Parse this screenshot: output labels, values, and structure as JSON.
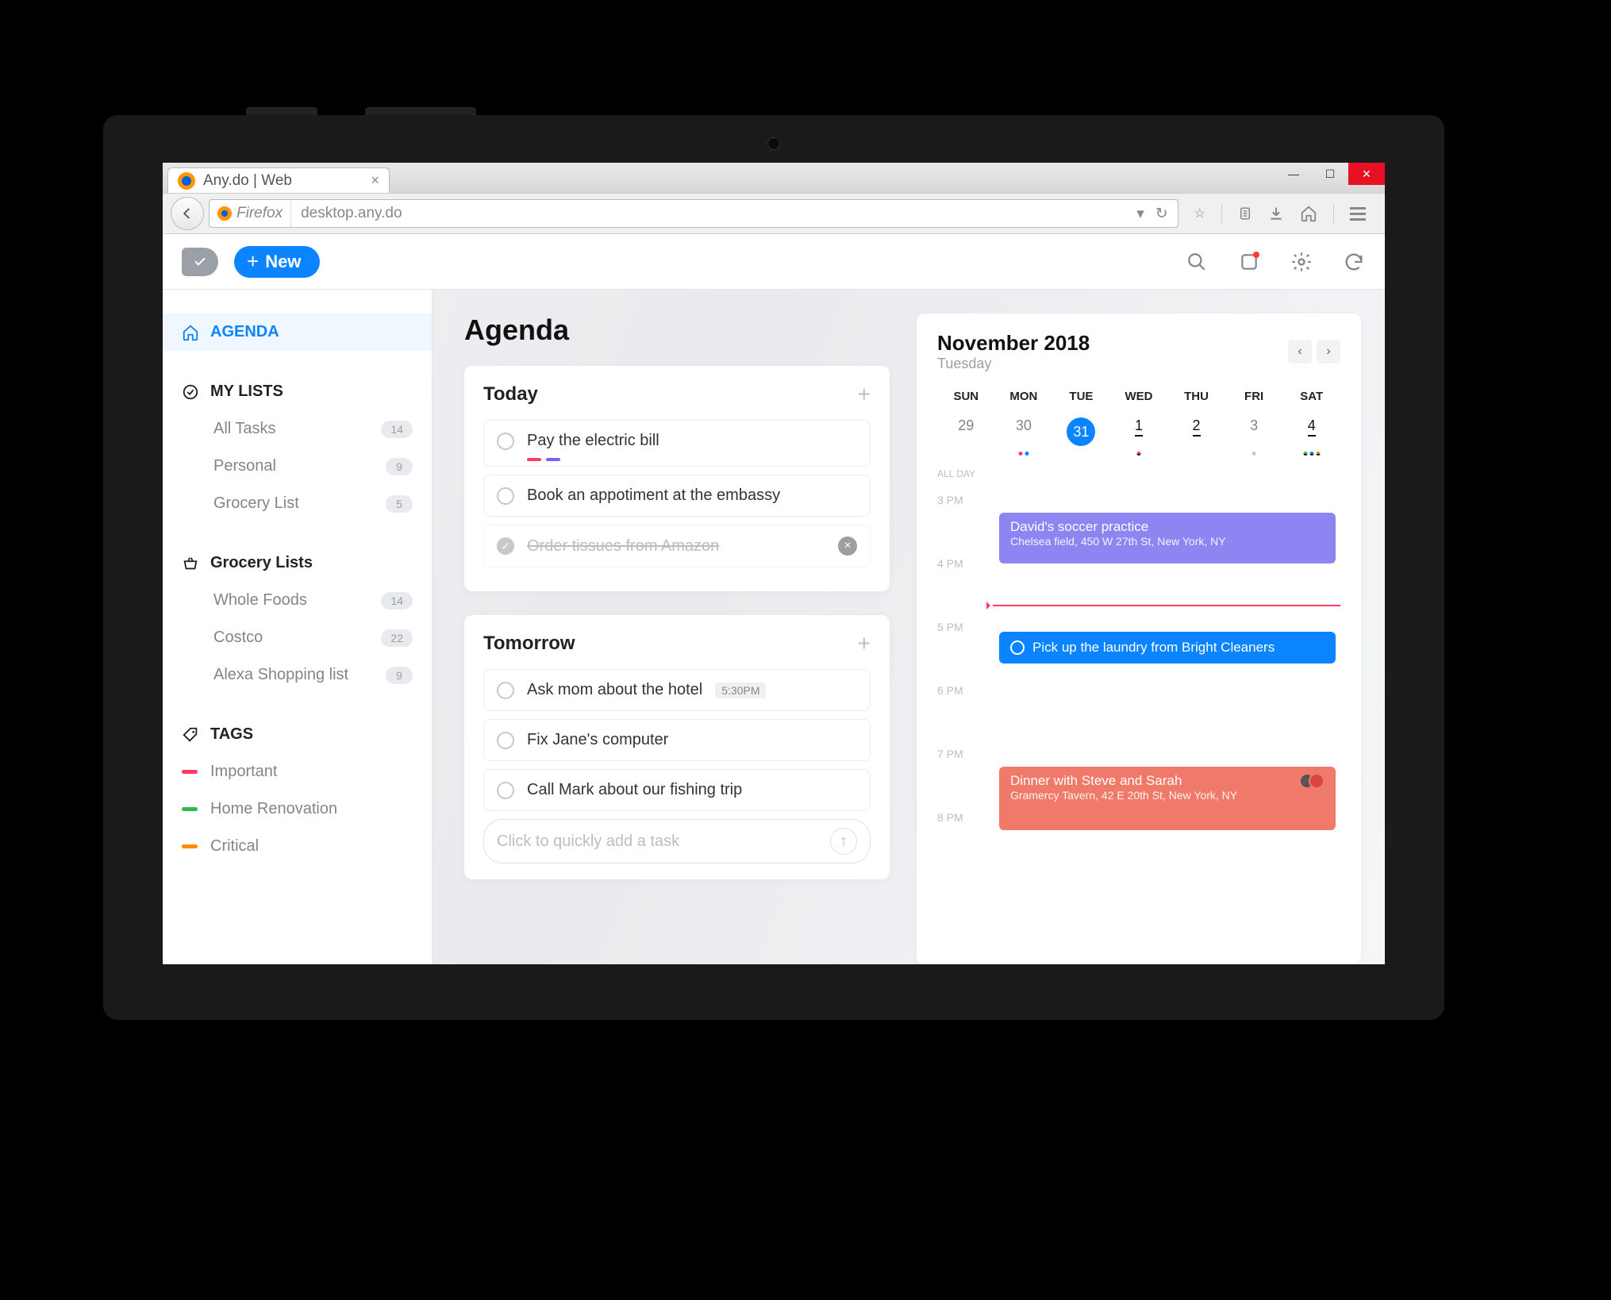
{
  "browser": {
    "tab_title": "Any.do | Web",
    "url_label": "Firefox",
    "url": "desktop.any.do"
  },
  "header": {
    "new_label": "New"
  },
  "sidebar": {
    "agenda_label": "AGENDA",
    "mylists_label": "MY LISTS",
    "mylists": [
      {
        "label": "All Tasks",
        "count": "14"
      },
      {
        "label": "Personal",
        "count": "9"
      },
      {
        "label": "Grocery List",
        "count": "5"
      }
    ],
    "grocery_label": "Grocery Lists",
    "grocery": [
      {
        "label": "Whole Foods",
        "count": "14"
      },
      {
        "label": "Costco",
        "count": "22"
      },
      {
        "label": "Alexa Shopping list",
        "count": "9"
      }
    ],
    "tags_label": "TAGS",
    "tags": [
      {
        "label": "Important",
        "color": "#ff3b68"
      },
      {
        "label": "Home Renovation",
        "color": "#2bbd4a"
      },
      {
        "label": "Critical",
        "color": "#ff8a00"
      }
    ]
  },
  "main": {
    "title": "Agenda",
    "today_label": "Today",
    "today_tasks": [
      {
        "text": "Pay the electric bill",
        "done": false,
        "tags": [
          "#ff3b68",
          "#7b61ff"
        ]
      },
      {
        "text": "Book an appotiment at the embassy",
        "done": false
      },
      {
        "text": "Order tissues from Amazon",
        "done": true,
        "removable": true
      }
    ],
    "tomorrow_label": "Tomorrow",
    "tomorrow_tasks": [
      {
        "text": "Ask mom about the hotel",
        "time": "5:30PM"
      },
      {
        "text": "Fix Jane's computer"
      },
      {
        "text": "Call Mark about our fishing trip"
      }
    ],
    "quick_add_placeholder": "Click to quickly add a task"
  },
  "calendar": {
    "month_label": "November 2018",
    "day_label": "Tuesday",
    "weekdays": [
      "SUN",
      "MON",
      "TUE",
      "WED",
      "THU",
      "FRI",
      "SAT"
    ],
    "dates": [
      "29",
      "30",
      "31",
      "1",
      "2",
      "3",
      "4"
    ],
    "selected_index": 2,
    "allday_label": "ALL DAY",
    "hours": [
      "3 PM",
      "4 PM",
      "5 PM",
      "6 PM",
      "7 PM",
      "8 PM"
    ],
    "events": [
      {
        "title": "David's soccer practice",
        "loc": "Chelsea field, 450 W 27th St, New York, NY",
        "color": "#8c85f2"
      },
      {
        "title": "Pick up the laundry from Bright Cleaners",
        "color": "#0a84ff",
        "ring": true
      },
      {
        "title": "Dinner with Steve and Sarah",
        "loc": "Gramercy Tavern, 42 E 20th St, New York, NY",
        "color": "#f07a6a"
      }
    ]
  }
}
